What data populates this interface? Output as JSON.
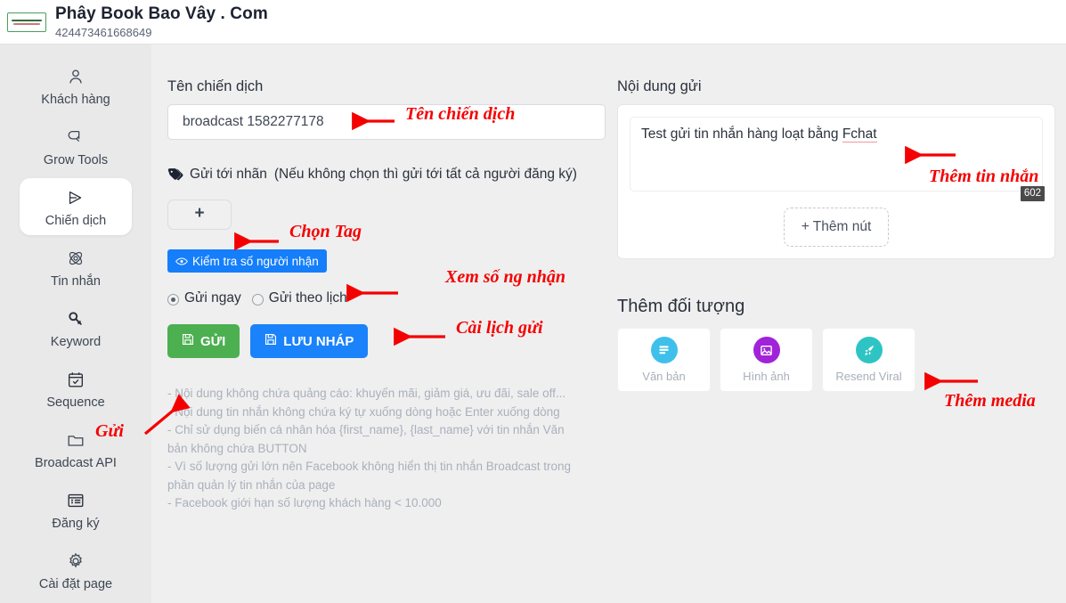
{
  "header": {
    "brand_title": "Phây Book Bao Vây . Com",
    "page_id": "424473461668649",
    "logo_name": "fchat-logo"
  },
  "sidebar": {
    "items": [
      {
        "label": "Khách hàng",
        "icon": "user-icon",
        "active": false
      },
      {
        "label": "Grow Tools",
        "icon": "magnet-icon",
        "active": false
      },
      {
        "label": "Chiến dịch",
        "icon": "send-icon",
        "active": true
      },
      {
        "label": "Tin nhắn",
        "icon": "atom-icon",
        "active": false
      },
      {
        "label": "Keyword",
        "icon": "key-icon",
        "active": false
      },
      {
        "label": "Sequence",
        "icon": "calendar-check-icon",
        "active": false
      },
      {
        "label": "Broadcast API",
        "icon": "folder-icon",
        "active": false
      },
      {
        "label": "Đăng ký",
        "icon": "list-icon",
        "active": false
      },
      {
        "label": "Cài đặt page",
        "icon": "gear-icon",
        "active": false
      }
    ]
  },
  "campaign": {
    "label": "Tên chiến dịch",
    "value": "broadcast 1582277178",
    "placeholder": "Tên chiến dịch"
  },
  "tag": {
    "icon": "tag-icon",
    "label": "Gửi tới nhãn",
    "note": "(Nếu không chọn thì gửi tới tất cả người đăng ký)",
    "add_label": "+"
  },
  "check_recipients": {
    "icon": "eye-icon",
    "label": "Kiểm tra số người nhận",
    "color": "#157efb"
  },
  "schedule": {
    "options": [
      {
        "label": "Gửi ngay",
        "selected": true
      },
      {
        "label": "Gửi theo lịch",
        "selected": false
      }
    ]
  },
  "actions": {
    "send_label": "GỬI",
    "send_icon": "save-icon",
    "send_color": "#4caf50",
    "draft_label": "LƯU NHÁP",
    "draft_icon": "save-icon",
    "draft_color": "#1a82fb"
  },
  "notes": [
    "- Nội dung không chứa quảng cáo: khuyến mãi, giảm giá, ưu đãi, sale off...",
    "- Nội dung tin nhắn không chứa ký tự xuống dòng hoặc Enter xuống dòng",
    "- Chỉ sử dụng biến cá nhân hóa {first_name}, {last_name} với tin nhắn Văn bản không chứa BUTTON",
    "- Vì số lượng gửi lớn nên Facebook không hiển thị tin nhắn Broadcast trong phần quản lý tin nhắn của page",
    "- Facebook giới hạn số lượng khách hàng < 10.000"
  ],
  "content": {
    "label": "Nội dung gửi",
    "message_prefix": "Test gửi tin nhắn hàng loạt bằng ",
    "message_spellword": "Fchat",
    "char_count": "602",
    "add_button_label": "+ Thêm nút"
  },
  "media": {
    "title": "Thêm đối tượng",
    "cards": [
      {
        "label": "Văn bản",
        "icon": "text-lines-icon",
        "color": "#3fc0ea"
      },
      {
        "label": "Hình ảnh",
        "icon": "image-icon",
        "color": "#a123d8"
      },
      {
        "label": "Resend Viral",
        "icon": "rocket-icon",
        "color": "#2ec4c4"
      }
    ]
  },
  "annotations": {
    "color": "#f50000",
    "items": [
      {
        "text": "Tên chiến dịch",
        "name": "annotation-campaign-name"
      },
      {
        "text": "Chọn Tag",
        "name": "annotation-choose-tag"
      },
      {
        "text": "Xem số ng nhận",
        "name": "annotation-view-recipients"
      },
      {
        "text": "Cài lịch gửi",
        "name": "annotation-set-schedule"
      },
      {
        "text": "Gửi",
        "name": "annotation-send"
      },
      {
        "text": "Thêm tin nhắn",
        "name": "annotation-add-message"
      },
      {
        "text": "Thêm media",
        "name": "annotation-add-media"
      }
    ]
  }
}
